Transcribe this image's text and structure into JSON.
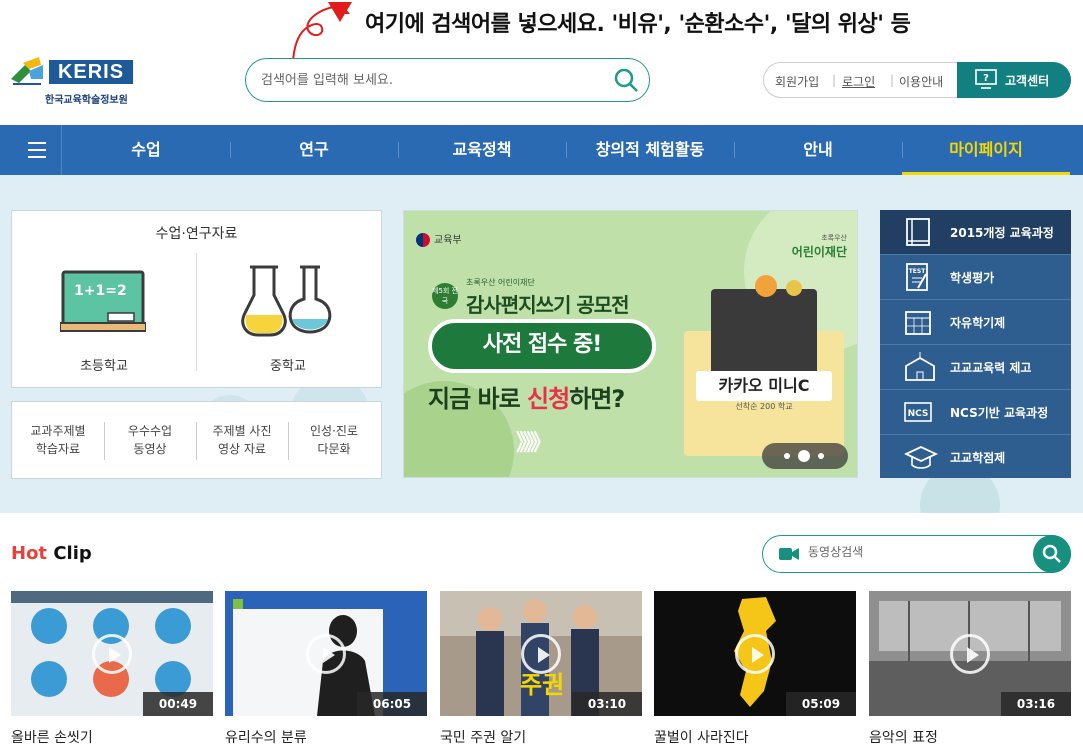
{
  "annotation": "여기에 검색어를 넣으세요. '비유', '순환소수', '달의 위상' 등",
  "logo": {
    "text": "KERIS",
    "subtitle": "한국교육학술정보원"
  },
  "search": {
    "placeholder": "검색어를 입력해 보세요."
  },
  "util": {
    "signup": "회원가입",
    "login": "로그인",
    "guide": "이용안내",
    "customer_center": "고객센터"
  },
  "nav": {
    "items": [
      "수업",
      "연구",
      "교육정책",
      "창의적 체험활동",
      "안내",
      "마이페이지"
    ],
    "active": "마이페이지"
  },
  "resources": {
    "title": "수업·연구자료",
    "elementary": {
      "label": "초등학교",
      "board_text": "1+1=2"
    },
    "middle": {
      "label": "중학교"
    },
    "links": [
      {
        "l1": "교과주제별",
        "l2": "학습자료"
      },
      {
        "l1": "우수수업",
        "l2": "동영상"
      },
      {
        "l1": "주제별 사진",
        "l2": "영상 자료"
      },
      {
        "l1": "인성·진로",
        "l2": "다문화"
      }
    ]
  },
  "banner": {
    "ministry": "교육부",
    "foundation_small": "초록우산",
    "foundation": "어린이재단",
    "badge": "제5회 전국",
    "small_title": "초록우산 어린이재단",
    "title": "감사편지쓰기 공모전",
    "pill": "사전 접수 중!",
    "line2_pre": "지금 바로 ",
    "line2_hl": "신청",
    "line2_post": "하면?",
    "arrows": "》》》",
    "product": "카카오 미니C",
    "product_sub": "선착순 200 학교"
  },
  "quick_menu": [
    {
      "label": "2015개정 교육과정",
      "icon": "book-icon"
    },
    {
      "label": "학생평가",
      "icon": "test-paper-icon"
    },
    {
      "label": "자유학기제",
      "icon": "calendar-icon"
    },
    {
      "label": "고교교육력 제고",
      "icon": "school-building-icon"
    },
    {
      "label": "NCS기반 교육과정",
      "icon": "ncs-icon"
    },
    {
      "label": "고교학점제",
      "icon": "graduation-cap-icon"
    }
  ],
  "hot_clip": {
    "title_hot": "Hot",
    "title_clip": " Clip",
    "video_search_placeholder": "동영상검색",
    "videos": [
      {
        "title": "올바른 손씻기",
        "duration": "00:49"
      },
      {
        "title": "유리수의 분류",
        "duration": "06:05"
      },
      {
        "title": "국민 주권 알기",
        "duration": "03:10",
        "overlay": "주권"
      },
      {
        "title": "꿀벌이 사라진다",
        "duration": "05:09"
      },
      {
        "title": "음악의 표정",
        "duration": "03:16"
      }
    ]
  },
  "colors": {
    "nav": "#2a6ab2",
    "accent_teal": "#1d9a8e",
    "active_nav": "#f5d800",
    "hot": "#e8403a"
  }
}
